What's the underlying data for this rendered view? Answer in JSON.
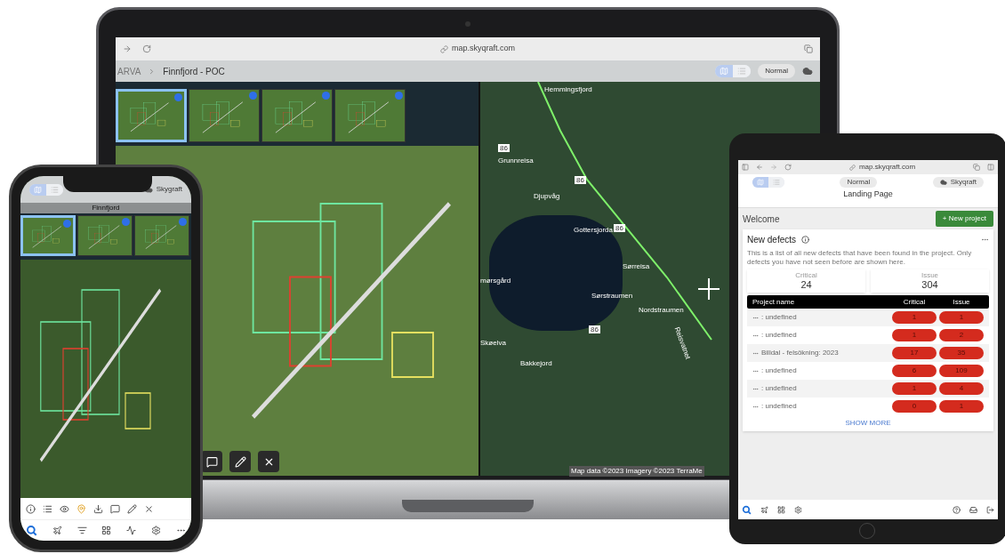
{
  "laptop": {
    "browser": {
      "url": "map.skyqraft.com",
      "nav": [
        {
          "kind": "forward"
        },
        {
          "kind": "reload"
        }
      ]
    },
    "breadcrumb": [
      "ARVA",
      "Finnfjord - POC"
    ],
    "view_toggle": [
      {
        "kind": "map",
        "selected": true
      },
      {
        "kind": "list",
        "selected": false
      }
    ],
    "mode": "Normal",
    "thumbnails": [
      {
        "selected": true
      },
      {
        "selected": false
      },
      {
        "selected": false
      },
      {
        "selected": false
      }
    ],
    "map_labels": [
      "Hemmingsfjord",
      "Grunnreisa",
      "Djupvåg",
      "Gottersjorda",
      "Sørreisa",
      "mørsgård",
      "Sørstraumen",
      "Nordstraumen",
      "Reisvatnet",
      "Skøelva",
      "Bakkejord"
    ],
    "road_shields": [
      "86",
      "86",
      "86",
      "86"
    ],
    "attribution": "Map data ©2023 Imagery ©2023 TerraMe",
    "tools": [
      {
        "kind": "comment"
      },
      {
        "kind": "edit"
      },
      {
        "kind": "close"
      }
    ]
  },
  "phone": {
    "view_toggle": [
      {
        "kind": "map",
        "selected": true
      },
      {
        "kind": "list",
        "selected": false
      }
    ],
    "account": "Skygraft",
    "title": "Finnfjord",
    "thumbnails": [
      {
        "selected": true
      },
      {
        "selected": false
      },
      {
        "selected": false
      }
    ],
    "tools": [
      {
        "kind": "info"
      },
      {
        "kind": "list"
      },
      {
        "kind": "eye"
      },
      {
        "kind": "pin"
      },
      {
        "kind": "download"
      },
      {
        "kind": "comment"
      },
      {
        "kind": "edit"
      },
      {
        "kind": "close"
      }
    ],
    "nav": [
      {
        "kind": "logo"
      },
      {
        "kind": "plane"
      },
      {
        "kind": "filter"
      },
      {
        "kind": "grid"
      },
      {
        "kind": "chart"
      },
      {
        "kind": "settings"
      },
      {
        "kind": "more"
      }
    ]
  },
  "tablet": {
    "browser": {
      "url": "map.skyqraft.com"
    },
    "view_toggle": [
      {
        "kind": "map",
        "selected": true
      },
      {
        "kind": "list",
        "selected": false
      }
    ],
    "mode": "Normal",
    "account": "Skyqraft",
    "page_title": "Landing Page",
    "welcome": "Welcome",
    "new_project": "+ New project",
    "card": {
      "title": "New defects",
      "description": "This is a list of all new defects that have been found in the project. Only defects you have not seen before are shown here.",
      "stats": [
        {
          "label": "Critical",
          "value": "24"
        },
        {
          "label": "Issue",
          "value": "304"
        }
      ],
      "table": {
        "columns": [
          "Project name",
          "Critical",
          "Issue"
        ],
        "rows": [
          {
            "name": ": undefined",
            "critical": "1",
            "issue": "1"
          },
          {
            "name": ": undefined",
            "critical": "1",
            "issue": "2"
          },
          {
            "name": "Billdal - felsökning: 2023",
            "critical": "17",
            "issue": "35"
          },
          {
            "name": ": undefined",
            "critical": "6",
            "issue": "109"
          },
          {
            "name": ": undefined",
            "critical": "1",
            "issue": "4"
          },
          {
            "name": ": undefined",
            "critical": "0",
            "issue": "1"
          }
        ]
      },
      "show_more": "SHOW MORE"
    },
    "nav_left": [
      {
        "kind": "logo"
      },
      {
        "kind": "plane"
      },
      {
        "kind": "grid"
      },
      {
        "kind": "settings"
      }
    ],
    "nav_right": [
      {
        "kind": "help"
      },
      {
        "kind": "inbox"
      },
      {
        "kind": "logout"
      }
    ]
  }
}
